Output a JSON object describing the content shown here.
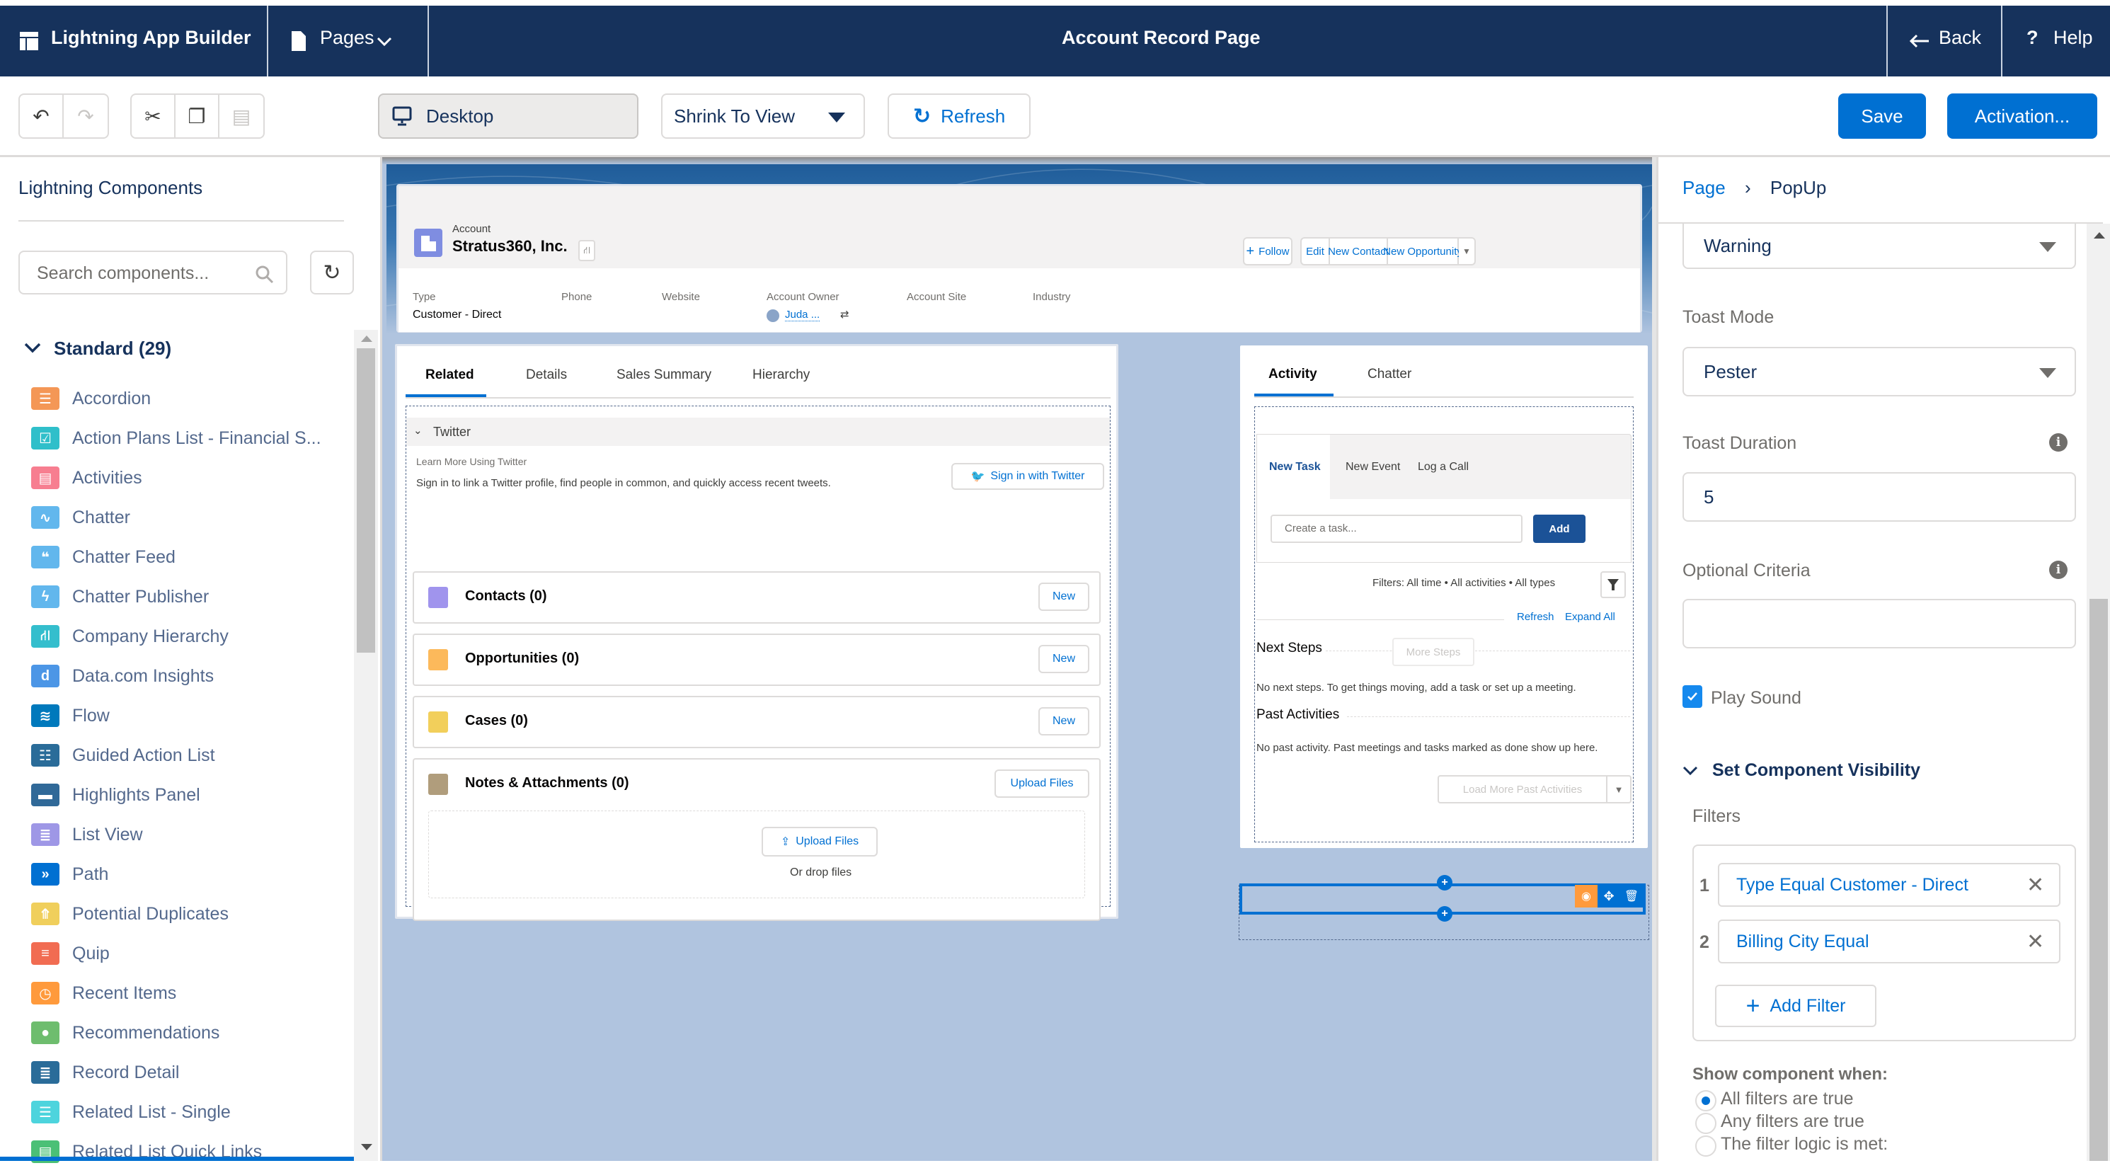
{
  "header": {
    "app_name": "Lightning App Builder",
    "pages_label": "Pages",
    "page_title": "Account Record Page",
    "back_label": "Back",
    "help_label": "Help"
  },
  "toolbar": {
    "device": "Desktop",
    "view_mode": "Shrink To View",
    "refresh_label": "Refresh",
    "save_label": "Save",
    "activation_label": "Activation..."
  },
  "left_panel": {
    "title": "Lightning Components",
    "search_placeholder": "Search components...",
    "section_label": "Standard (29)",
    "components": [
      {
        "label": "Accordion",
        "icon": "accordion-icon",
        "color": "#f49756"
      },
      {
        "label": "Action Plans List - Financial S...",
        "icon": "action-plan-icon",
        "color": "#2fbfca"
      },
      {
        "label": "Activities",
        "icon": "activities-icon",
        "color": "#f77e90"
      },
      {
        "label": "Chatter",
        "icon": "chatter-icon",
        "color": "#62b7ed"
      },
      {
        "label": "Chatter Feed",
        "icon": "chatter-feed-icon",
        "color": "#62b7ed"
      },
      {
        "label": "Chatter Publisher",
        "icon": "chatter-publisher-icon",
        "color": "#62b7ed"
      },
      {
        "label": "Company Hierarchy",
        "icon": "hierarchy-icon",
        "color": "#34becd"
      },
      {
        "label": "Data.com Insights",
        "icon": "datacom-icon",
        "color": "#4c96e6"
      },
      {
        "label": "Flow",
        "icon": "flow-icon",
        "color": "#0079bc"
      },
      {
        "label": "Guided Action List",
        "icon": "guided-action-icon",
        "color": "#2a6c99"
      },
      {
        "label": "Highlights Panel",
        "icon": "highlights-panel-icon",
        "color": "#306998"
      },
      {
        "label": "List View",
        "icon": "list-view-icon",
        "color": "#9e97e6"
      },
      {
        "label": "Path",
        "icon": "path-icon",
        "color": "#0070d2"
      },
      {
        "label": "Potential Duplicates",
        "icon": "duplicates-icon",
        "color": "#f0cf5c"
      },
      {
        "label": "Quip",
        "icon": "quip-icon",
        "color": "#f16c52"
      },
      {
        "label": "Recent Items",
        "icon": "clock-icon",
        "color": "#ff9a3c"
      },
      {
        "label": "Recommendations",
        "icon": "lightbulb-icon",
        "color": "#6ebd6e"
      },
      {
        "label": "Record Detail",
        "icon": "record-detail-icon",
        "color": "#2a6c99"
      },
      {
        "label": "Related List - Single",
        "icon": "related-list-icon",
        "color": "#4dd4dd"
      },
      {
        "label": "Related List Quick Links",
        "icon": "quick-links-icon",
        "color": "#4bc076"
      }
    ]
  },
  "record": {
    "object_label": "Account",
    "name": "Stratus360, Inc.",
    "actions": [
      "Follow",
      "Edit",
      "New Contact",
      "New Opportunity"
    ],
    "fields": [
      {
        "label": "Type",
        "value": "Customer - Direct"
      },
      {
        "label": "Phone",
        "value": ""
      },
      {
        "label": "Website",
        "value": ""
      },
      {
        "label": "Account Owner",
        "value": "Juda ..."
      },
      {
        "label": "Account Site",
        "value": ""
      },
      {
        "label": "Industry",
        "value": ""
      }
    ]
  },
  "main_tabs": [
    "Related",
    "Details",
    "Sales Summary",
    "Hierarchy"
  ],
  "twitter": {
    "title": "Twitter",
    "learn_more": "Learn More Using Twitter",
    "description": "Sign in to link a Twitter profile, find people in common, and quickly access recent tweets.",
    "signin_label": "Sign in with Twitter"
  },
  "related_lists": [
    {
      "title": "Contacts (0)",
      "button": "New",
      "color": "#a094ed"
    },
    {
      "title": "Opportunities (0)",
      "button": "New",
      "color": "#fcb95b"
    },
    {
      "title": "Cases (0)",
      "button": "New",
      "color": "#f2cf5b"
    },
    {
      "title": "Notes & Attachments (0)",
      "button": "Upload Files",
      "color": "#b09d7c"
    }
  ],
  "upload": {
    "button": "Upload Files",
    "drop_text": "Or drop files"
  },
  "activity": {
    "tabs": [
      "Activity",
      "Chatter"
    ],
    "sub_tabs": [
      "New Task",
      "New Event",
      "Log a Call"
    ],
    "task_placeholder": "Create a task...",
    "add_label": "Add",
    "filters_text": "Filters: All time • All activities • All types",
    "refresh_link": "Refresh",
    "expand_link": "Expand All",
    "next_steps_title": "Next Steps",
    "more_steps_label": "More Steps",
    "next_steps_empty": "No next steps. To get things moving, add a task or set up a meeting.",
    "past_title": "Past Activities",
    "past_empty": "No past activity. Past meetings and tasks marked as done show up here.",
    "load_more_label": "Load More Past Activities"
  },
  "properties": {
    "breadcrumb_root": "Page",
    "breadcrumb_current": "PopUp",
    "toast_type_value": "Warning",
    "toast_mode_label": "Toast Mode",
    "toast_mode_value": "Pester",
    "toast_duration_label": "Toast Duration",
    "toast_duration_value": "5",
    "optional_criteria_label": "Optional Criteria",
    "optional_criteria_value": "",
    "play_sound_label": "Play Sound",
    "play_sound_checked": true,
    "visibility_title": "Set Component Visibility",
    "filters_label": "Filters",
    "filters": [
      {
        "num": "1",
        "text": "Type Equal Customer - Direct"
      },
      {
        "num": "2",
        "text": "Billing City Equal"
      }
    ],
    "add_filter_label": "Add Filter",
    "show_when_label": "Show component when:",
    "show_options": [
      "All filters are true",
      "Any filters are true",
      "The filter logic is met:"
    ],
    "show_selected": 0
  }
}
